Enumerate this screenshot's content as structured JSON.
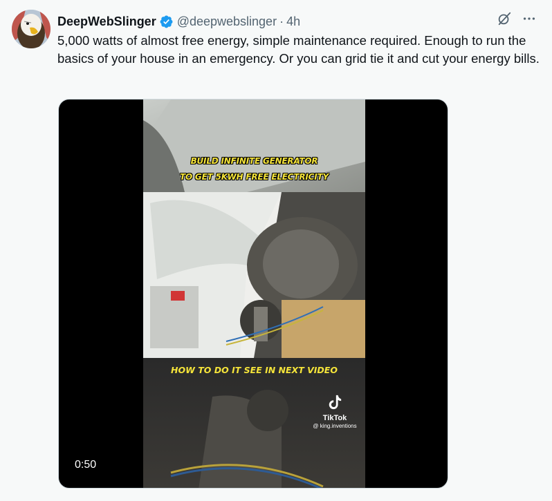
{
  "author": {
    "display_name": "DeepWebSlinger",
    "handle": "@deepwebslinger",
    "separator": "·",
    "time": "4h",
    "avatar_icon": "eagle-avatar",
    "verified_icon": "verified-badge-icon",
    "verified_color": "#1d9bf0"
  },
  "tweet": {
    "text": "5,000 watts of almost free energy, simple maintenance required. Enough to run the basics of your house in an emergency. Or you can grid tie it and cut your energy bills."
  },
  "actions": {
    "grok_icon": "grok-icon",
    "more_icon": "more-icon"
  },
  "video": {
    "caption_line1": "BUILD INFINITE GENERATOR",
    "caption_line2": "TO GET 5KWH FREE ELECTRICITY",
    "caption_bottom": "HOW TO DO IT SEE IN NEXT VIDEO",
    "watermark_name": "TikTok",
    "watermark_user": "@ king.inventions",
    "duration": "0:50",
    "caption_color": "#f5e43a"
  }
}
